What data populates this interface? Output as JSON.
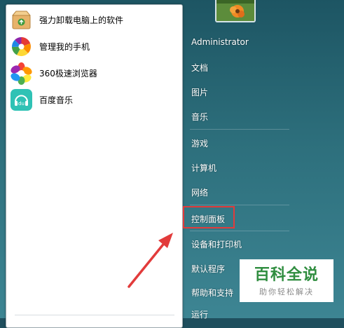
{
  "programs": [
    {
      "label": "强力卸载电脑上的软件",
      "icon": "uninstaller-box-icon"
    },
    {
      "label": "管理我的手机",
      "icon": "phone-manager-icon"
    },
    {
      "label": "360极速浏览器",
      "icon": "browser-360-icon"
    },
    {
      "label": "百度音乐",
      "icon": "baidu-music-icon"
    }
  ],
  "user": {
    "name": "Administrator",
    "avatar": "flower-avatar"
  },
  "right_menu": {
    "documents": "文档",
    "pictures": "图片",
    "music": "音乐",
    "games": "游戏",
    "computer": "计算机",
    "network": "网络",
    "control_panel": "控制面板",
    "devices_printers": "设备和打印机",
    "default_programs": "默认程序",
    "help_support": "帮助和支持",
    "run": "运行"
  },
  "annotations": {
    "highlight_color": "#e23b3b",
    "arrow_color": "#e23b3b"
  },
  "watermark": {
    "title": "百科全说",
    "subtitle": "助你轻松解决",
    "color": "#2f8d3f"
  }
}
